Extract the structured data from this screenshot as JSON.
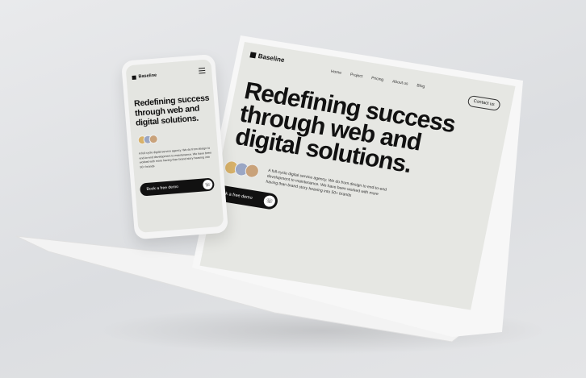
{
  "laptop": {
    "brand": "Baseline",
    "nav": [
      "Home",
      "Project",
      "Pricing",
      "About us",
      "Blog"
    ],
    "contact_button": "Contact us",
    "headline": [
      "Redefining success",
      "through web and",
      "digital solutions."
    ],
    "description": "A full-cycle digital service agency. We do from design to end-to-end development to maintenance. We have been worked with more having than brand story heaving into 50+ brands",
    "cta": "Book a free demo"
  },
  "phone": {
    "brand": "Baseline",
    "headline": [
      "Redefining success",
      "through web and",
      "digital solutions."
    ],
    "description": "A full-cycle digital service agency. We do from design to end-to-end development to maintenance. We have been worked with more having than brand story heaving into 50+ brands",
    "cta": "Book a free demo"
  }
}
